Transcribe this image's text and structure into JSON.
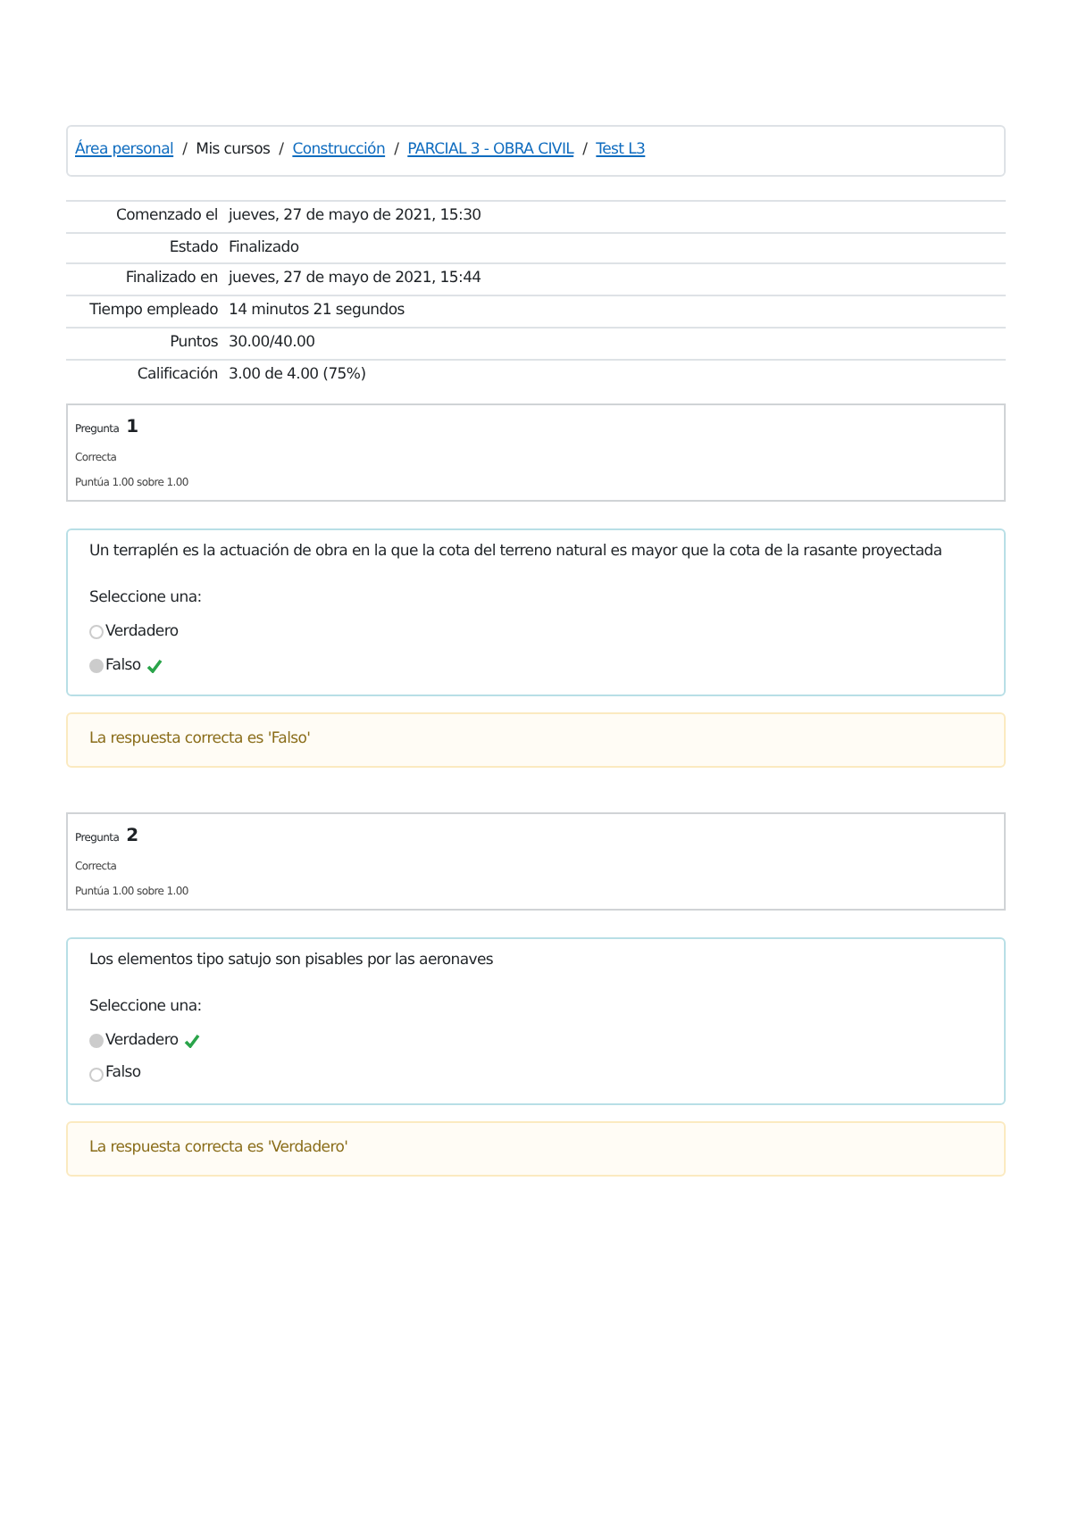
{
  "breadcrumb": [
    {
      "label": "Área personal",
      "link": true
    },
    {
      "separator": "/",
      "label": "Mis cursos",
      "link": false
    },
    {
      "separator": "/",
      "label": "Construcción",
      "link": true
    },
    {
      "separator": "/",
      "label": "PARCIAL 3 - OBRA CIVIL",
      "link": true
    },
    {
      "separator": "/",
      "label": "Test L3",
      "link": true
    }
  ],
  "summary": [
    {
      "label": "Comenzado el",
      "value": "jueves, 27 de mayo de 2021, 15:30"
    },
    {
      "label": "Estado",
      "value": "Finalizado"
    },
    {
      "label": "Finalizado en",
      "value": "jueves, 27 de mayo de 2021, 15:44"
    },
    {
      "label": "Tiempo empleado",
      "value": "14 minutos 21 segundos"
    },
    {
      "label": "Puntos",
      "value": "30.00/40.00"
    },
    {
      "label": "Calificación",
      "value": "3.00 de 4.00 (75%)"
    }
  ],
  "questions": [
    {
      "label": "Pregunta",
      "number": "1",
      "state": "Correcta",
      "grade": "Puntúa 1.00 sobre 1.00",
      "text": "Un terraplén es la actuación de obra en la que la cota del terreno natural es mayor que la cota de la rasante proyectada",
      "prompt": "Seleccione una:",
      "options": [
        {
          "label": "Verdadero",
          "selected": false,
          "correct": false
        },
        {
          "label": "Falso",
          "selected": true,
          "correct": true
        }
      ],
      "feedback": "La respuesta correcta es 'Falso'"
    },
    {
      "label": "Pregunta",
      "number": "2",
      "state": "Correcta",
      "grade": "Puntúa 1.00 sobre 1.00",
      "text": "Los elementos tipo satujo son pisables por las aeronaves",
      "prompt": "Seleccione una:",
      "options": [
        {
          "label": "Verdadero",
          "selected": true,
          "correct": true
        },
        {
          "label": "Falso",
          "selected": false,
          "correct": false
        }
      ],
      "feedback": "La respuesta correcta es 'Verdadero'"
    }
  ]
}
